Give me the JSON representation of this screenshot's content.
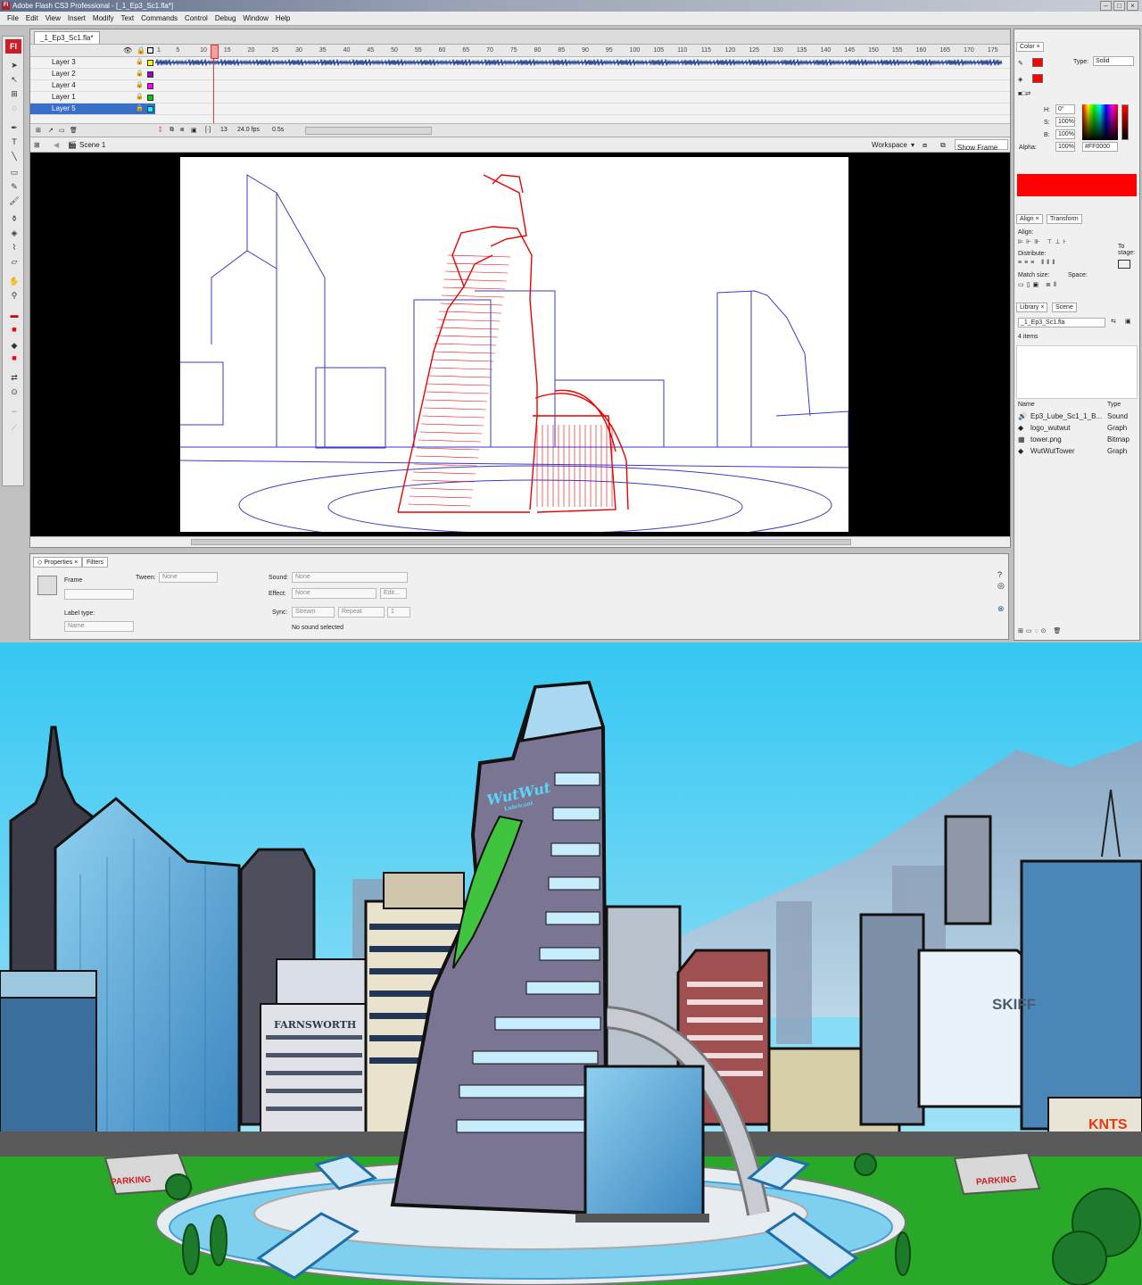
{
  "window": {
    "title": "Adobe Flash CS3 Professional - [_1_Ep3_Sc1.fla*]",
    "app_badge": "Fl"
  },
  "menu": [
    "File",
    "Edit",
    "View",
    "Insert",
    "Modify",
    "Text",
    "Commands",
    "Control",
    "Debug",
    "Window",
    "Help"
  ],
  "document": {
    "tab": "_1_Ep3_Sc1.fla*"
  },
  "timeline": {
    "frame_numbers": [
      "1",
      "5",
      "10",
      "15",
      "20",
      "25",
      "30",
      "35",
      "40",
      "45",
      "50",
      "55",
      "60",
      "65",
      "70",
      "75",
      "80",
      "85",
      "90",
      "95",
      "100",
      "105",
      "110",
      "115",
      "120",
      "125",
      "130",
      "135",
      "140",
      "145",
      "150",
      "155",
      "160",
      "165",
      "170",
      "175"
    ],
    "layers": [
      {
        "name": "Layer 3",
        "color": "#ffff00"
      },
      {
        "name": "Layer 2",
        "color": "#9900cc"
      },
      {
        "name": "Layer 4",
        "color": "#ff00ff"
      },
      {
        "name": "Layer 1",
        "color": "#00cc00"
      },
      {
        "name": "Layer 5",
        "color": "#00ffff"
      }
    ],
    "current_frame": "13",
    "fps": "24.0 fps",
    "time": "0.5s"
  },
  "editbar": {
    "scene": "Scene 1",
    "workspace": "Workspace",
    "view_option": "Show Frame"
  },
  "properties": {
    "tabs": [
      "Properties",
      "Filters"
    ],
    "frame_label": "Frame",
    "tween_label": "Tween:",
    "tween_value": "None",
    "label_type": "Label type:",
    "label_type_value": "Name",
    "sound_label": "Sound:",
    "sound_value": "None",
    "effect_label": "Effect:",
    "effect_value": "None",
    "edit_button": "Edit...",
    "sync_label": "Sync:",
    "sync_value": "Stream",
    "repeat_value": "Repeat",
    "repeat_count": "1",
    "status": "No sound selected"
  },
  "color_panel": {
    "tab": "Color",
    "type_label": "Type:",
    "type_value": "Solid",
    "h_label": "H:",
    "h_value": "0°",
    "s_label": "S:",
    "s_value": "100%",
    "b_label": "B:",
    "b_value": "100%",
    "alpha_label": "Alpha:",
    "alpha_value": "100%",
    "hex": "#FF0000",
    "color": "#ff0000"
  },
  "align_panel": {
    "tabs": [
      "Align",
      "Transform"
    ],
    "align": "Align:",
    "distribute": "Distribute:",
    "match_size": "Match size:",
    "space": "Space:",
    "to_stage": "To stage:"
  },
  "library_panel": {
    "tabs": [
      "Library",
      "Scene"
    ],
    "file": "_1_Ep3_Sc1.fla",
    "count": "4 items",
    "col_name": "Name",
    "col_type": "Type",
    "items": [
      {
        "name": "Ep3_Lube_Sc1_1_B...",
        "type": "Sound",
        "icon": "sound-icon"
      },
      {
        "name": "logo_wutwut",
        "type": "Graph",
        "icon": "graphic-icon"
      },
      {
        "name": "tower.png",
        "type": "Bitmap",
        "icon": "bitmap-icon"
      },
      {
        "name": "WutWutTower",
        "type": "Graph",
        "icon": "graphic-icon"
      }
    ]
  },
  "artwork": {
    "logo": "WutWut",
    "logo_sub": "Lubricant",
    "sign_farnsworth": "FARNSWORTH",
    "sign_knts": "KNTS",
    "sign_skiff": "SKIFF",
    "parking": "PARKING"
  }
}
